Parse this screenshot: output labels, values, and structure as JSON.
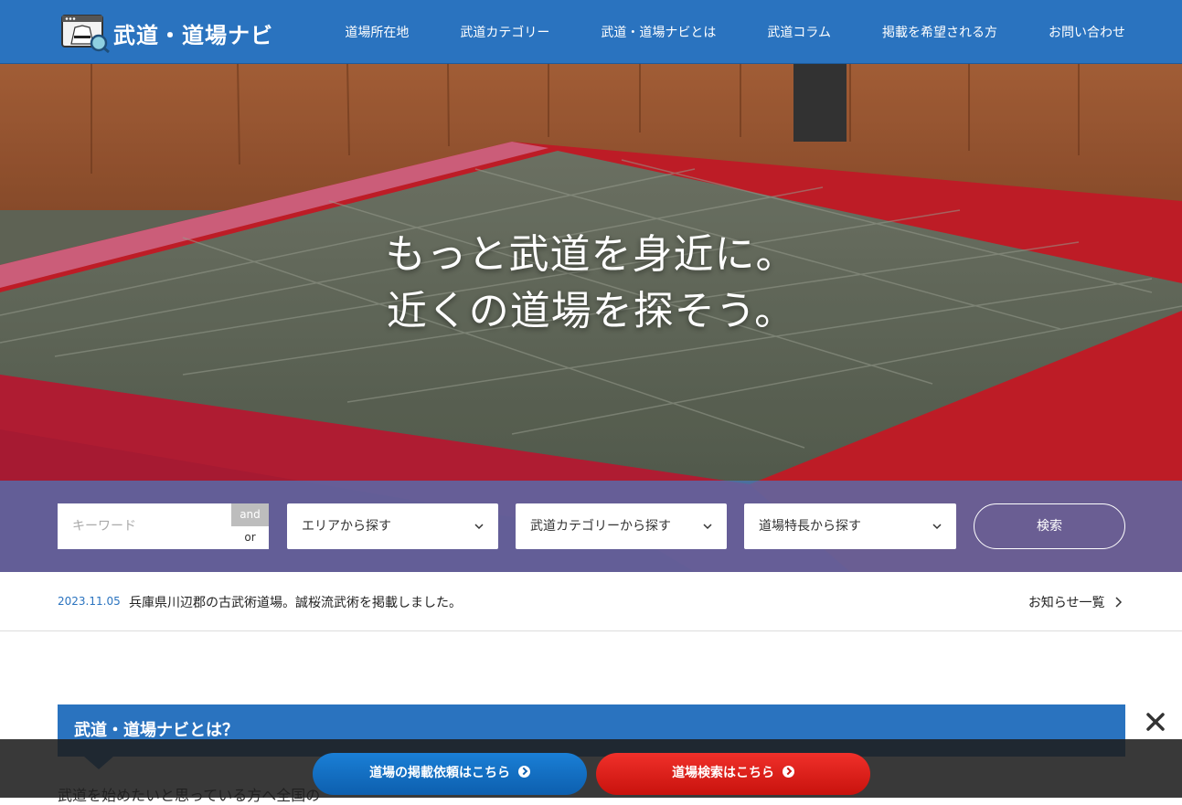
{
  "header": {
    "logo_text": "武道・道場ナビ",
    "nav": [
      "道場所在地",
      "武道カテゴリー",
      "武道・道場ナビとは",
      "武道コラム",
      "掲載を希望される方",
      "お問い合わせ"
    ]
  },
  "hero": {
    "line1": "もっと武道を身近に。",
    "line2": "近くの道場を探そう。"
  },
  "search": {
    "keyword_placeholder": "キーワード",
    "and_label": "and",
    "or_label": "or",
    "area_label": "エリアから探す",
    "category_label": "武道カテゴリーから探す",
    "feature_label": "道場特長から探す",
    "search_label": "検索"
  },
  "news": {
    "date": "2023.11.05",
    "text": "兵庫県川辺郡の古武術道場。誠桜流武術を掲載しました。",
    "more_label": "お知らせ一覧"
  },
  "about": {
    "heading": "武道・道場ナビとは？",
    "body": "武道を始めたいと思っている方へ全国の"
  },
  "cta": {
    "listing_label": "道場の掲載依頼はこちら",
    "search_label": "道場検索はこちら"
  },
  "colors": {
    "brand_blue": "#2a73bf",
    "cta_red": "#e01b16"
  }
}
